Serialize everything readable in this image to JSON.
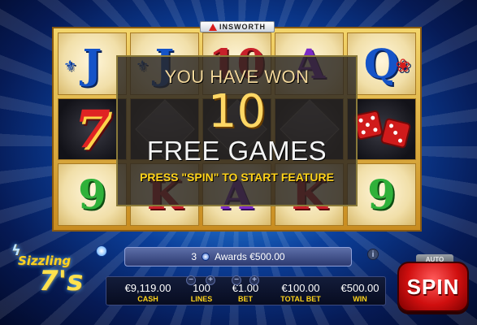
{
  "brand": {
    "name": "INSWORTH"
  },
  "reels": [
    [
      "J",
      "J",
      "10",
      "A",
      "Q"
    ],
    [
      "7",
      "",
      "",
      "",
      "dice"
    ],
    [
      "9",
      "K",
      "A",
      "K",
      "9"
    ]
  ],
  "overlay": {
    "line1": "YOU HAVE WON",
    "count": "10",
    "line2": "FREE GAMES",
    "line3": "PRESS \"SPIN\" TO START FEATURE"
  },
  "logo": {
    "line1": "Sizzling",
    "line2": "7's"
  },
  "awards": {
    "count": "3",
    "text": "Awards €500.00"
  },
  "meters": {
    "cash": {
      "value": "€9,119.00",
      "label": "CASH"
    },
    "lines": {
      "value": "100",
      "label": "LINES"
    },
    "bet": {
      "value": "€1.00",
      "label": "BET"
    },
    "total_bet": {
      "value": "€100.00",
      "label": "TOTAL BET"
    },
    "win": {
      "value": "€500.00",
      "label": "WIN"
    }
  },
  "buttons": {
    "auto": "AUTO",
    "spin": "SPIN",
    "plus": "+",
    "minus": "−"
  },
  "icons": {
    "info": "i",
    "fleur": "⚜",
    "rose": "❀",
    "bolt": "ϟ"
  },
  "colors": {
    "accent": "#ffd31a",
    "spin": "#d00f0f",
    "frame": "#c88c20"
  }
}
